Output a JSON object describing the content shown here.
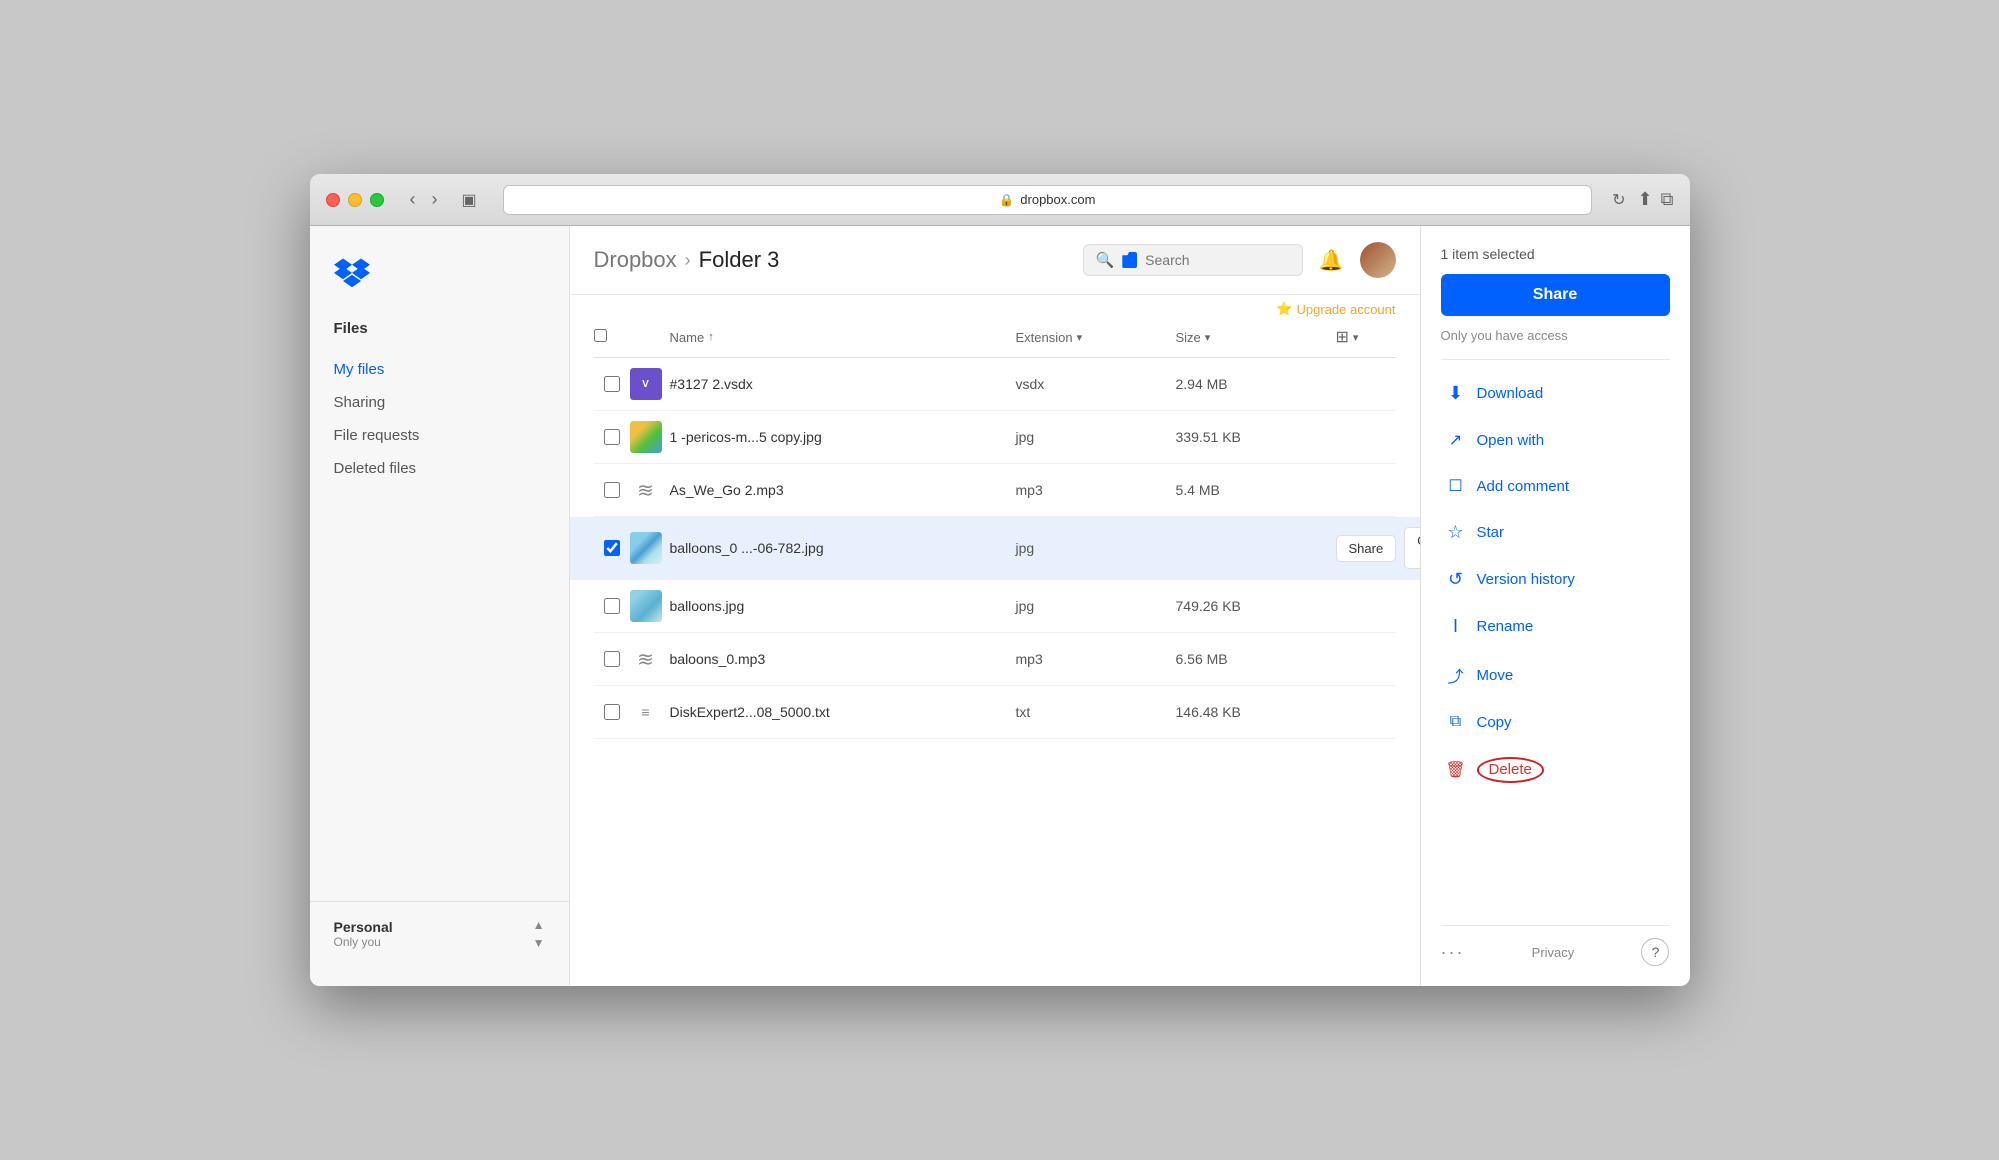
{
  "window": {
    "url": "dropbox.com",
    "title": "Dropbox - Folder 3"
  },
  "upgrade": {
    "label": "Upgrade account"
  },
  "breadcrumb": {
    "root": "Dropbox",
    "sep": "›",
    "folder": "Folder 3"
  },
  "search": {
    "placeholder": "Search"
  },
  "table": {
    "headers": {
      "name": "Name",
      "name_sort": "↑",
      "extension": "Extension",
      "size": "Size",
      "view_options": "⋮"
    },
    "files": [
      {
        "id": 1,
        "name": "#3127 2.vsdx",
        "ext": "vsdx",
        "size": "2.94 MB",
        "type": "vsdx",
        "selected": false
      },
      {
        "id": 2,
        "name": "1 -pericos-m...5 copy.jpg",
        "ext": "jpg",
        "size": "339.51 KB",
        "type": "jpg-parrot",
        "selected": false
      },
      {
        "id": 3,
        "name": "As_We_Go 2.mp3",
        "ext": "mp3",
        "size": "5.4 MB",
        "type": "mp3",
        "selected": false
      },
      {
        "id": 4,
        "name": "balloons_0 ...-06-782.jpg",
        "ext": "jpg",
        "size": "",
        "type": "jpg-balloon",
        "selected": true
      },
      {
        "id": 5,
        "name": "balloons.jpg",
        "ext": "jpg",
        "size": "749.26 KB",
        "type": "jpg-balloon2",
        "selected": false
      },
      {
        "id": 6,
        "name": "baloons_0.mp3",
        "ext": "mp3",
        "size": "6.56 MB",
        "type": "mp3",
        "selected": false
      },
      {
        "id": 7,
        "name": "DiskExpert2...08_5000.txt",
        "ext": "txt",
        "size": "146.48 KB",
        "type": "txt",
        "selected": false
      }
    ]
  },
  "file_row_actions": {
    "share": "Share",
    "open_with": "Open with",
    "open_with_arrow": "▾"
  },
  "right_panel": {
    "selection_count": "1 item selected",
    "share_button": "Share",
    "access_text": "Only you have access",
    "actions": [
      {
        "id": "download",
        "icon": "⬇",
        "label": "Download"
      },
      {
        "id": "open_with",
        "icon": "↗",
        "label": "Open with"
      },
      {
        "id": "add_comment",
        "icon": "☐",
        "label": "Add comment"
      },
      {
        "id": "star",
        "icon": "☆",
        "label": "Star"
      },
      {
        "id": "version_history",
        "icon": "↺",
        "label": "Version history"
      },
      {
        "id": "rename",
        "icon": "I",
        "label": "Rename"
      },
      {
        "id": "move",
        "icon": "→□",
        "label": "Move"
      },
      {
        "id": "copy",
        "icon": "⧉",
        "label": "Copy"
      },
      {
        "id": "delete",
        "icon": "🗑",
        "label": "Delete",
        "danger": true
      }
    ],
    "footer": {
      "dots": "···",
      "privacy": "Privacy",
      "help": "?"
    }
  },
  "sidebar": {
    "logo_alt": "Dropbox",
    "nav_files": "Files",
    "items": [
      {
        "id": "my-files",
        "label": "My files",
        "active": true
      },
      {
        "id": "sharing",
        "label": "Sharing",
        "active": false
      },
      {
        "id": "file-requests",
        "label": "File requests",
        "active": false
      },
      {
        "id": "deleted-files",
        "label": "Deleted files",
        "active": false
      }
    ],
    "account": {
      "title": "Personal",
      "subtitle": "Only you"
    }
  }
}
